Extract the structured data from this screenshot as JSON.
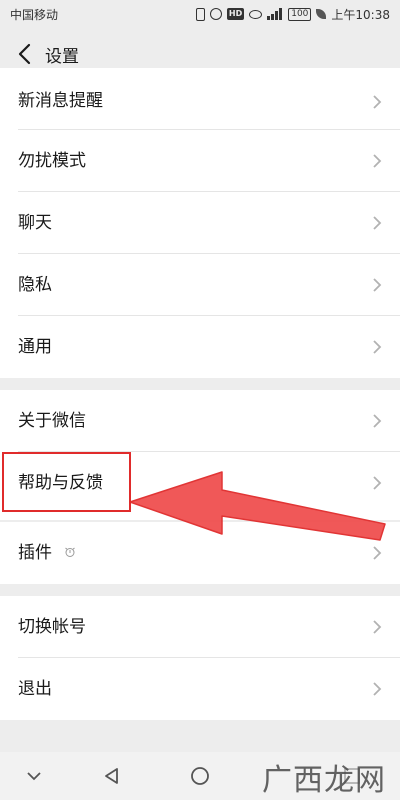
{
  "status_bar": {
    "carrier": "中国移动",
    "hd_label": "HD",
    "battery_level": "100",
    "time": "上午10:38"
  },
  "header": {
    "title": "设置"
  },
  "groups": [
    {
      "items": [
        {
          "label": "新消息提醒"
        },
        {
          "label": "勿扰模式"
        },
        {
          "label": "聊天"
        },
        {
          "label": "隐私"
        },
        {
          "label": "通用"
        }
      ]
    },
    {
      "items": [
        {
          "label": "关于微信"
        },
        {
          "label": "帮助与反馈",
          "highlighted": true
        }
      ]
    },
    {
      "items": [
        {
          "label": "插件",
          "badge_icon": "plugin-bell-icon"
        }
      ]
    },
    {
      "items": [
        {
          "label": "切换帐号"
        },
        {
          "label": "退出"
        }
      ]
    }
  ],
  "annotation": {
    "color": "#e02b2b",
    "target": "帮助与反馈"
  },
  "watermark": {
    "text": "广西龙网"
  },
  "nav_bar": {
    "icons": [
      "collapse-chevron-icon",
      "back-triangle-icon",
      "home-circle-icon",
      "recents-square-icon"
    ]
  }
}
